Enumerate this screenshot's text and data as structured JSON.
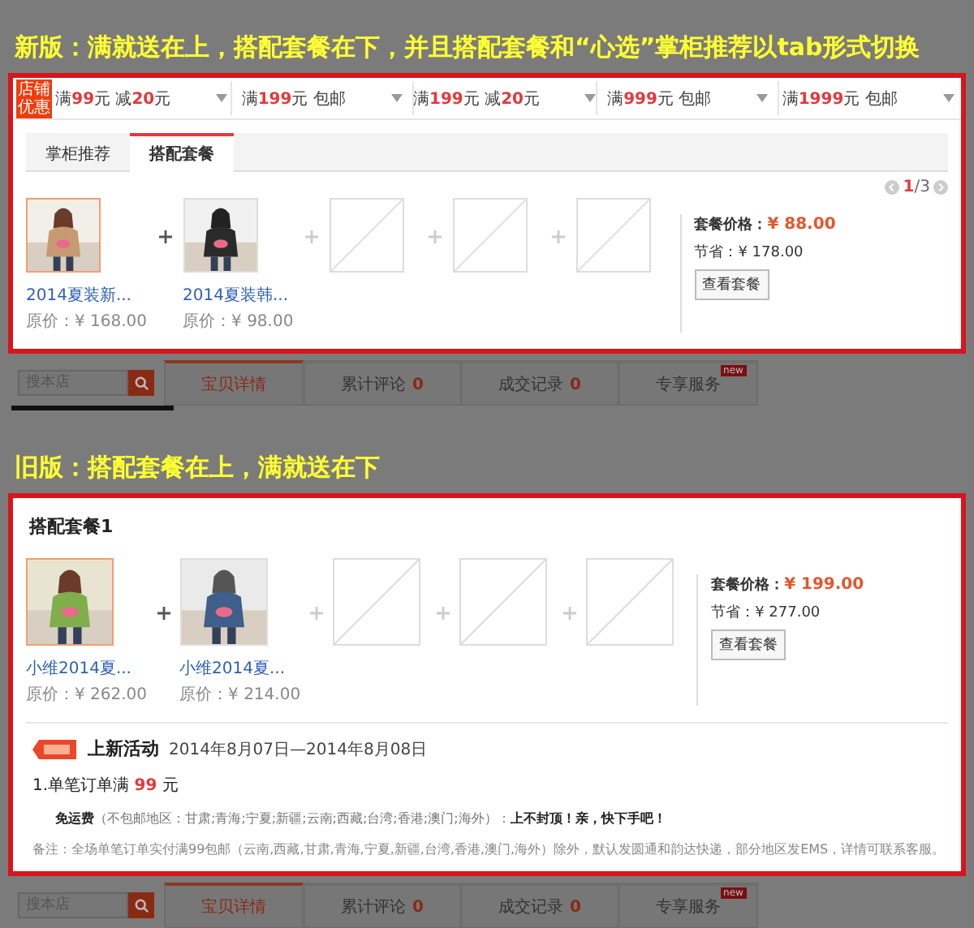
{
  "new_version": {
    "caption": "新版：满就送在上，搭配套餐在下，并且搭配套餐和“心选”掌柜推荐以tab形式切换",
    "coupon_badge": "店铺优惠",
    "coupons": [
      {
        "segments": [
          {
            "text": "满",
            "highlight": false
          },
          {
            "text": "99",
            "highlight": true
          },
          {
            "text": "元 减",
            "highlight": false
          },
          {
            "text": "20",
            "highlight": true
          },
          {
            "text": "元",
            "highlight": false
          }
        ]
      },
      {
        "segments": [
          {
            "text": "满",
            "highlight": false
          },
          {
            "text": "199",
            "highlight": true
          },
          {
            "text": "元 包邮",
            "highlight": false
          }
        ]
      },
      {
        "segments": [
          {
            "text": "满",
            "highlight": false
          },
          {
            "text": "199",
            "highlight": true
          },
          {
            "text": "元 减",
            "highlight": false
          },
          {
            "text": "20",
            "highlight": true
          },
          {
            "text": "元",
            "highlight": false
          }
        ]
      },
      {
        "segments": [
          {
            "text": "满",
            "highlight": false
          },
          {
            "text": "999",
            "highlight": true
          },
          {
            "text": "元 包邮",
            "highlight": false
          }
        ]
      },
      {
        "segments": [
          {
            "text": "满",
            "highlight": false
          },
          {
            "text": "1999",
            "highlight": true
          },
          {
            "text": "元 包邮",
            "highlight": false
          }
        ]
      }
    ],
    "tabs": [
      {
        "label": "掌柜推荐",
        "selected": false
      },
      {
        "label": "搭配套餐",
        "selected": true
      }
    ],
    "pager": {
      "current": "1",
      "total": "/3"
    },
    "items": [
      {
        "kind": "product",
        "title": "2014夏装新...",
        "price": "原价：¥ 168.00"
      },
      {
        "kind": "product",
        "title": "2014夏装韩...",
        "price": "原价：¥ 98.00"
      },
      {
        "kind": "empty"
      },
      {
        "kind": "empty"
      },
      {
        "kind": "empty"
      }
    ],
    "summary": {
      "price_label": "套餐价格：",
      "price": "¥ 88.00",
      "save": "节省：¥ 178.00",
      "button": "查看套餐"
    }
  },
  "page_bar": {
    "search_placeholder": "搜本店",
    "tabs": [
      {
        "label": "宝贝详情",
        "selected": true
      },
      {
        "label": "累计评论",
        "count": "0",
        "selected": false
      },
      {
        "label": "成交记录",
        "count": "0",
        "selected": false
      },
      {
        "label": "专享服务",
        "badge": "new",
        "selected": false
      }
    ]
  },
  "old_version": {
    "caption": "旧版：搭配套餐在上，满就送在下",
    "title": "搭配套餐1",
    "items": [
      {
        "kind": "product",
        "title": "小维2014夏...",
        "price": "原价：¥ 262.00"
      },
      {
        "kind": "product",
        "title": "小维2014夏...",
        "price": "原价：¥ 214.00"
      },
      {
        "kind": "empty"
      },
      {
        "kind": "empty"
      },
      {
        "kind": "empty"
      }
    ],
    "summary": {
      "price_label": "套餐价格：",
      "price": "¥ 199.00",
      "save": "节省：¥ 277.00",
      "button": "查看套餐"
    },
    "promo": {
      "title": "上新活动",
      "dates": "2014年8月07日—2014年8月08日",
      "rule": [
        {
          "text": "1.单笔订单满 ",
          "highlight": false
        },
        {
          "text": "99",
          "highlight": true
        },
        {
          "text": " 元",
          "highlight": false
        }
      ],
      "detail": "**免运费**（不包邮地区：甘肃;青海;宁夏;新疆;云南;西藏;台湾;香港;澳门;海外）：**上不封顶！亲，快下手吧！**",
      "note": "备注：全场单笔订单实付满99包邮（云南,西藏,甘肃,青海,宁夏,新疆,台湾,香港,澳门,海外）除外，默认发圆通和韵达快递，部分地区发EMS，详情可联系客服。"
    }
  },
  "page_bar_bottom": {
    "search_placeholder": "搜本店",
    "tabs": [
      {
        "label": "宝贝详情",
        "selected": true
      },
      {
        "label": "累计评论",
        "count": "0",
        "selected": false
      },
      {
        "label": "成交记录",
        "count": "0",
        "selected": false
      },
      {
        "label": "专享服务",
        "badge": "new",
        "selected": false
      }
    ]
  }
}
